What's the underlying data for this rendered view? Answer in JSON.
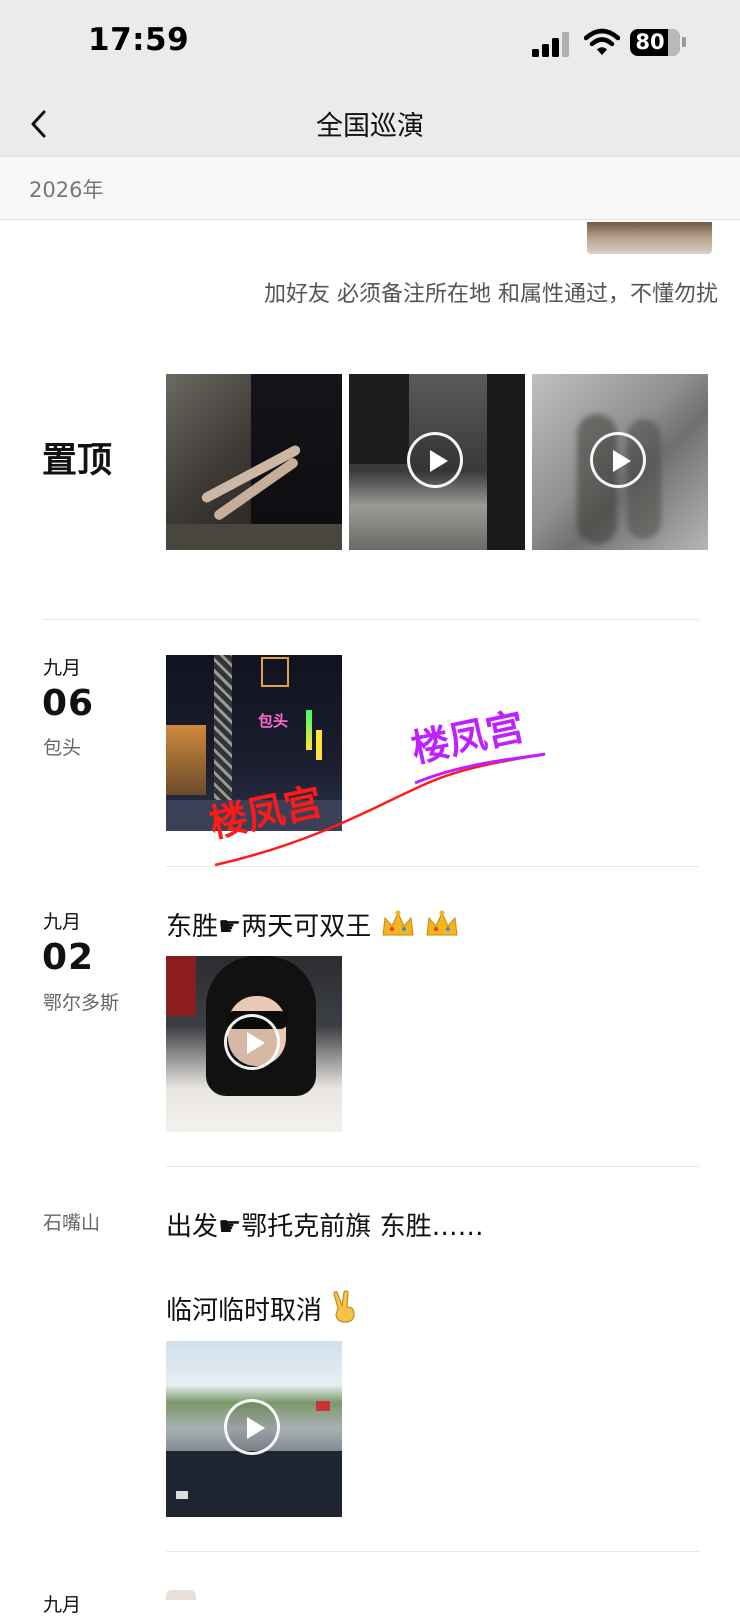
{
  "status": {
    "time": "17:59",
    "battery": "80"
  },
  "nav": {
    "title": "全国巡演"
  },
  "year": {
    "label": "2026年"
  },
  "intro": {
    "text": "加好友 必须备注所在地 和属性通过，不懂勿扰"
  },
  "pinned": {
    "label": "置顶"
  },
  "posts": [
    {
      "month": "九月",
      "day": "06",
      "location": "包头",
      "watermark": "楼凤宫"
    },
    {
      "month": "九月",
      "day": "02",
      "location": "鄂尔多斯",
      "text": "东胜☛两天可双王"
    },
    {
      "location": "石嘴山",
      "text_line1": "出发☛鄂托克前旗 东胜……",
      "text_line2": "临河临时取消"
    },
    {
      "month": "九月"
    }
  ],
  "colors": {
    "watermark_red": "#ff1a1a",
    "watermark_purple": "#c020ff"
  }
}
